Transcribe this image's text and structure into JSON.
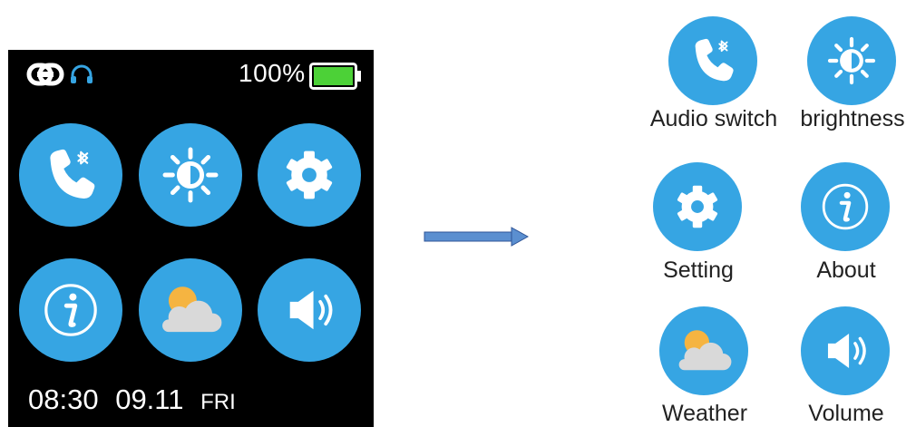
{
  "status_bar": {
    "battery_percent": "100%",
    "battery_level": 1.0,
    "icons": [
      "link-icon",
      "headset-icon",
      "battery-icon"
    ]
  },
  "clock": {
    "time": "08:30",
    "date": "09.11",
    "day": "FRI"
  },
  "watch_grid": [
    {
      "icon": "bluetooth-phone-icon"
    },
    {
      "icon": "brightness-icon"
    },
    {
      "icon": "gear-icon"
    },
    {
      "icon": "info-icon"
    },
    {
      "icon": "weather-icon"
    },
    {
      "icon": "volume-icon"
    }
  ],
  "legend": {
    "audio_switch": "Audio switch",
    "brightness": "brightness",
    "setting": "Setting",
    "about": "About",
    "weather": "Weather",
    "volume": "Volume"
  },
  "colors": {
    "accent": "#36A5E3",
    "battery": "#4CD137",
    "sun": "#F5B441",
    "cloud": "#D9D9D9",
    "arrow": "#5B8FD0"
  }
}
